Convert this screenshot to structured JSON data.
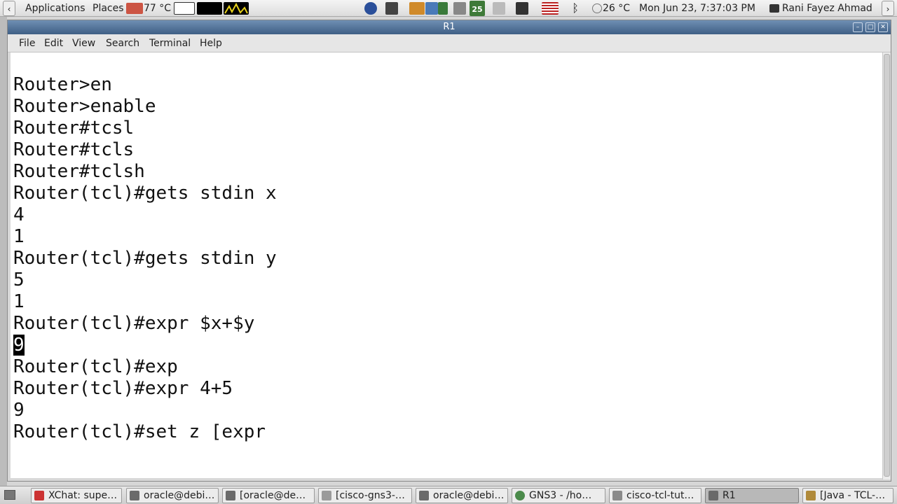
{
  "top_panel": {
    "applications": "Applications",
    "places": "Places",
    "weather_left": "77 °C",
    "weather_right": "26 °C",
    "clock": "Mon Jun 23,  7:37:03 PM",
    "user": "Rani Fayez Ahmad",
    "calendar_day": "25"
  },
  "window": {
    "title": "R1",
    "menu": [
      "File",
      "Edit",
      "View",
      "Search",
      "Terminal",
      "Help"
    ]
  },
  "terminal": {
    "lines": [
      "Router>en",
      "Router>enable",
      "Router#tcsl",
      "Router#tcls",
      "Router#tclsh",
      "Router(tcl)#gets stdin x",
      "4",
      "1",
      "Router(tcl)#gets stdin y",
      "5",
      "1",
      "Router(tcl)#expr $x+$y",
      "9",
      "Router(tcl)#exp",
      "Router(tcl)#expr 4+5",
      "9",
      "Router(tcl)#set z [expr"
    ]
  },
  "taskbar": {
    "tasks": [
      {
        "label": "XChat: supe…",
        "icon": "xchat-icon"
      },
      {
        "label": "oracle@debi…",
        "icon": "terminal-icon"
      },
      {
        "label": "[oracle@de…",
        "icon": "terminal-icon"
      },
      {
        "label": "[cisco-gns3-…",
        "icon": "editor-icon"
      },
      {
        "label": "oracle@debi…",
        "icon": "terminal-icon"
      },
      {
        "label": "GNS3 - /ho…",
        "icon": "gns3-icon"
      },
      {
        "label": "cisco-tcl-tut…",
        "icon": "folder-icon"
      },
      {
        "label": "R1",
        "icon": "terminal-icon"
      },
      {
        "label": "[Java - TCL-…",
        "icon": "java-icon"
      }
    ]
  }
}
